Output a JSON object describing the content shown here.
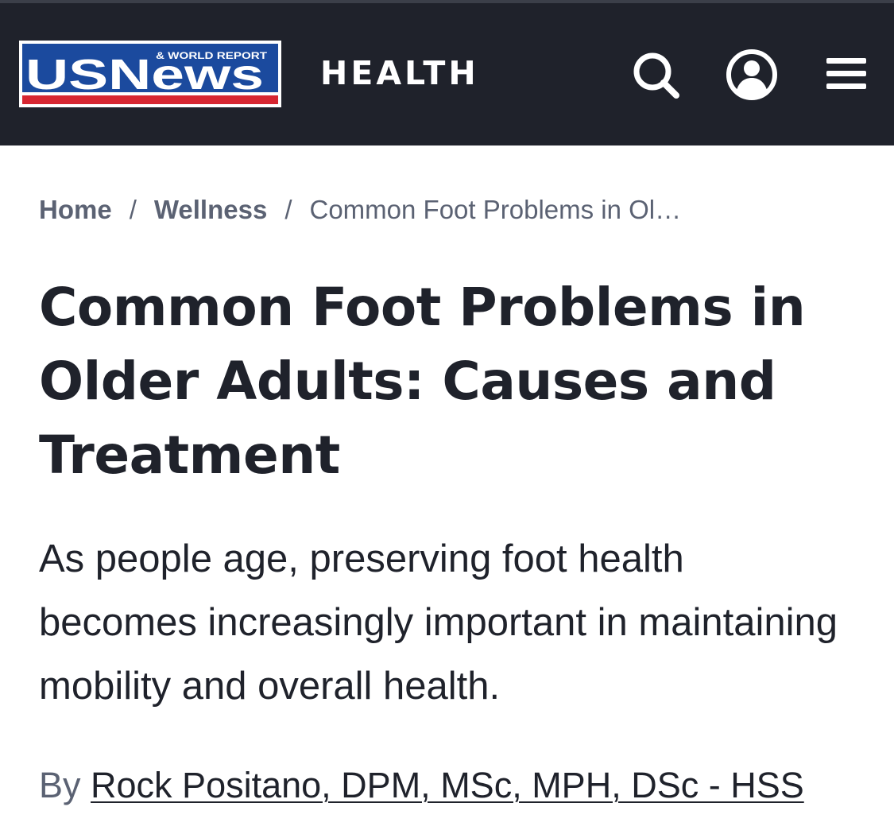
{
  "header": {
    "logo": {
      "wordmark": "USNews",
      "tagline": "& WORLD REPORT",
      "colors": {
        "blue": "#1b4a9e",
        "red": "#d62631",
        "white": "#ffffff"
      }
    },
    "section": "HEALTH",
    "icons": {
      "search": "search-icon",
      "account": "user-icon",
      "menu": "hamburger-menu-icon"
    },
    "background_color": "#1f222b"
  },
  "breadcrumb": {
    "items": [
      {
        "label": "Home"
      },
      {
        "label": "Wellness"
      }
    ],
    "separator": "/",
    "current": "Common Foot Problems in Ol…"
  },
  "article": {
    "title": "Common Foot Problems in Older Adults: Causes and Treatment",
    "dek": "As people age, preserving foot health becomes increasingly important in maintaining mobility and overall health.",
    "byline_prefix": "By",
    "author": "Rock Positano, DPM, MSc, MPH, DSc - HSS"
  },
  "colors": {
    "text_dark": "#1f222b",
    "text_muted": "#5b6273",
    "header_bg": "#1f222b"
  }
}
